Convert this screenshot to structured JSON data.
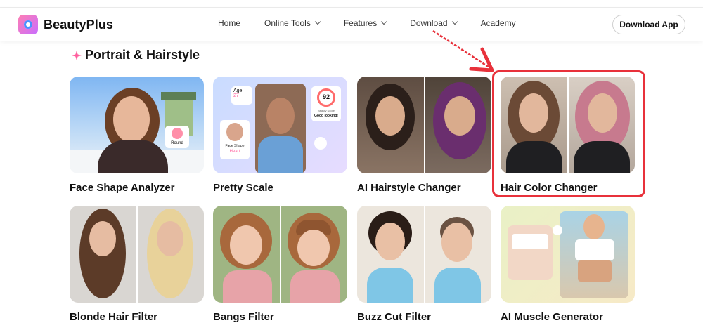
{
  "brand": {
    "name": "BeautyPlus"
  },
  "nav": {
    "items": [
      {
        "label": "Home",
        "dropdown": false
      },
      {
        "label": "Online Tools",
        "dropdown": true
      },
      {
        "label": "Features",
        "dropdown": true
      },
      {
        "label": "Download",
        "dropdown": true
      },
      {
        "label": "Academy",
        "dropdown": false
      }
    ],
    "cta": "Download App"
  },
  "section": {
    "title": "Portrait & Hairstyle"
  },
  "tools": [
    {
      "label": "Face Shape Analyzer"
    },
    {
      "label": "Pretty Scale"
    },
    {
      "label": "AI Hairstyle Changer"
    },
    {
      "label": "Hair Color Changer",
      "highlighted": true
    },
    {
      "label": "Blonde Hair Filter"
    },
    {
      "label": "Bangs Filter"
    },
    {
      "label": "Buzz Cut Filter"
    },
    {
      "label": "AI Muscle Generator"
    }
  ],
  "overlays": {
    "round_tag": "Round",
    "age_label": "Age",
    "age_value": "27",
    "score_value": "92",
    "score_caption": "Beauty Score",
    "score_text": "Good looking!",
    "face_shape_label": "Face Shape",
    "face_shape_value": "Heart"
  },
  "colors": {
    "highlight": "#e8313b",
    "accent": "#ff5f9e"
  }
}
